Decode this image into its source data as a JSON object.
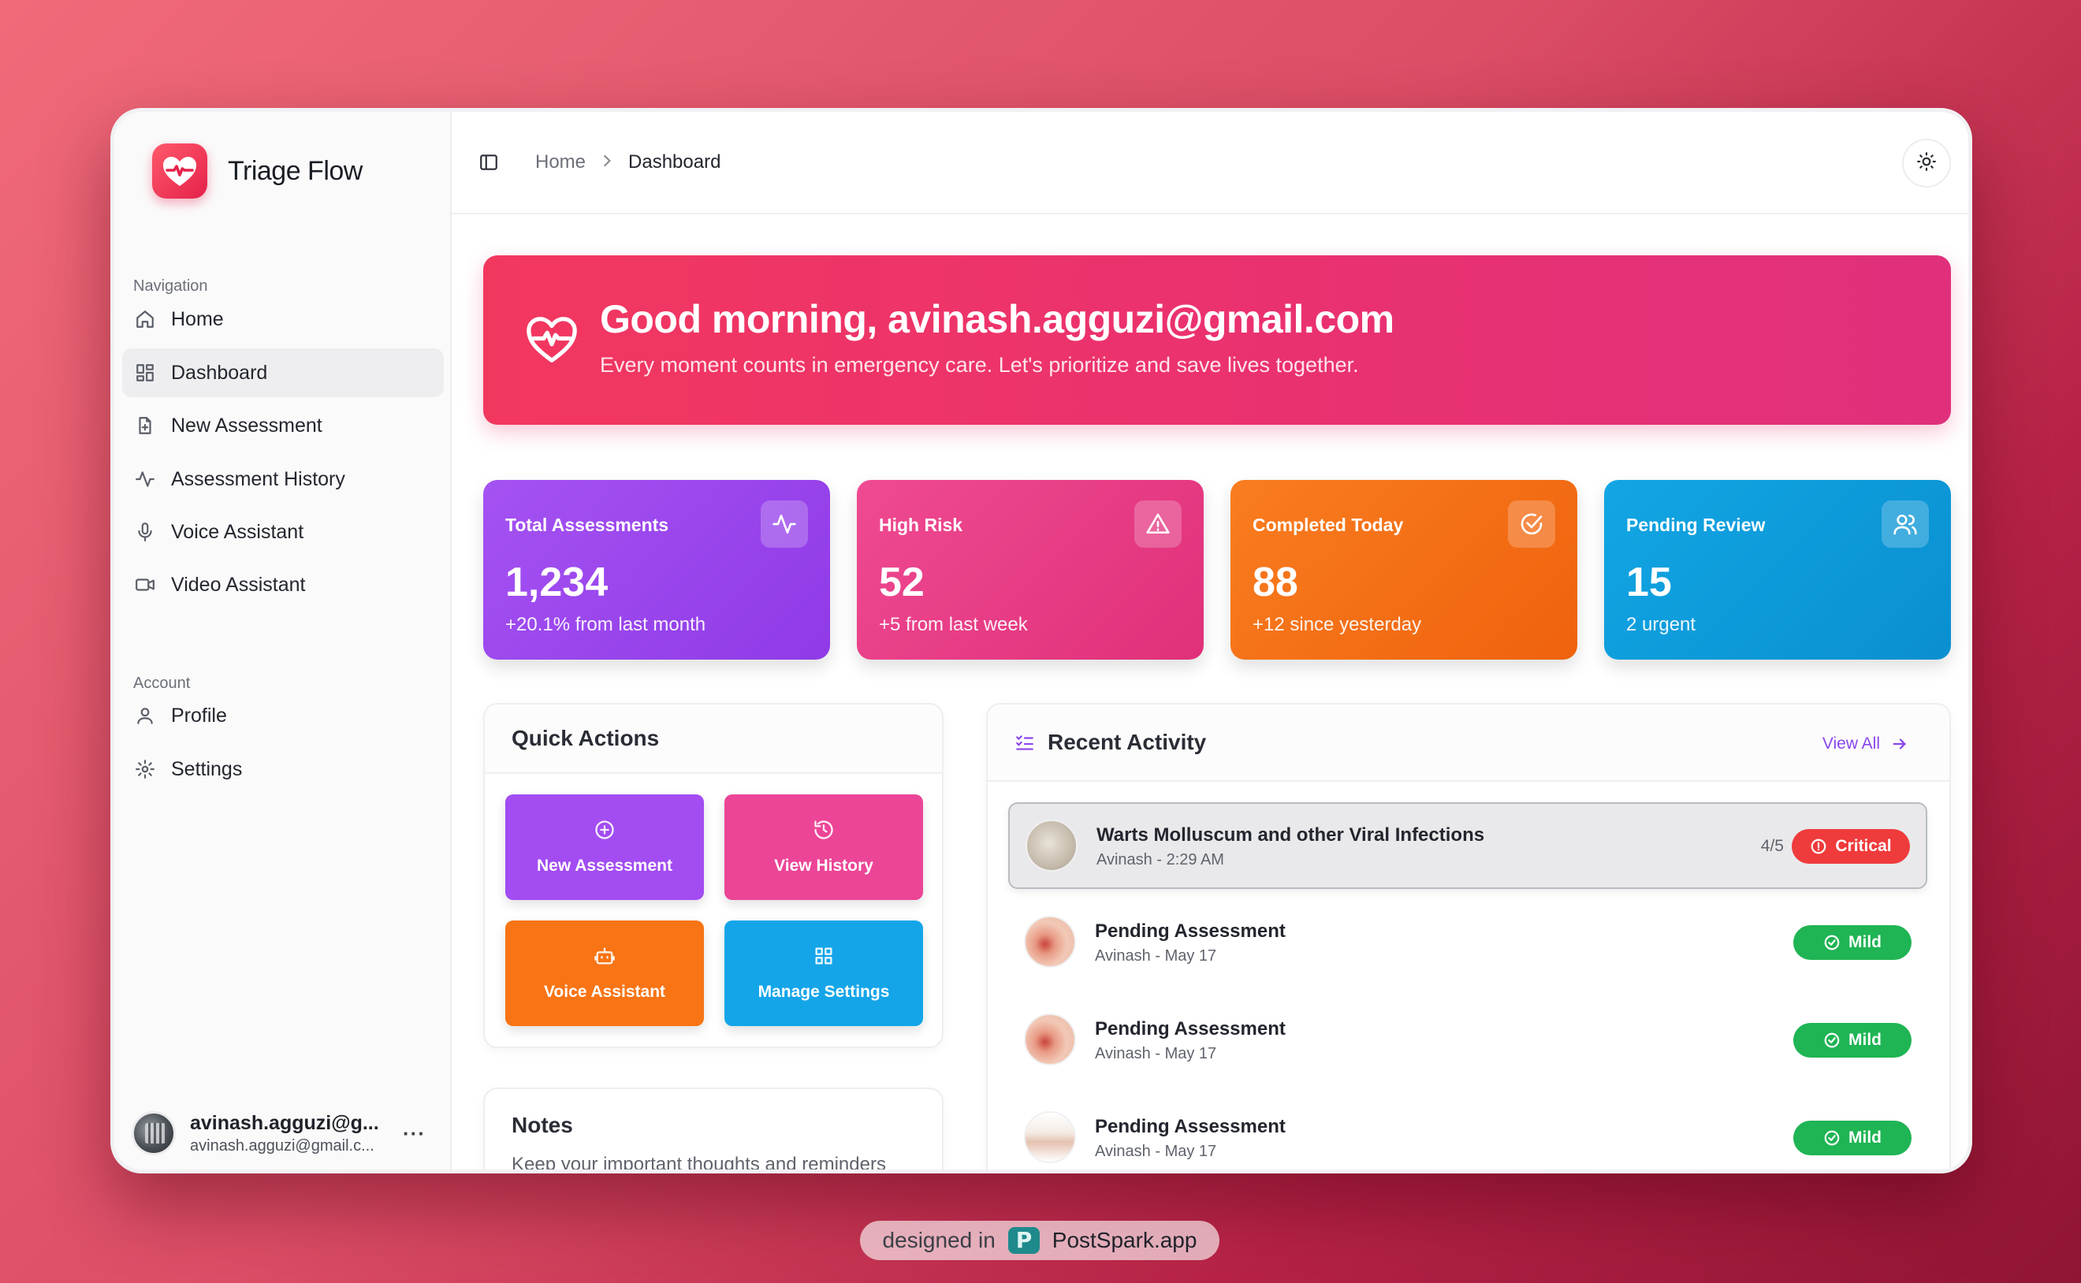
{
  "app": {
    "name": "Triage Flow",
    "accent": "#e4214a"
  },
  "sidebar": {
    "nav_label": "Navigation",
    "nav_items": [
      {
        "label": "Home",
        "icon": "home-icon",
        "active": false
      },
      {
        "label": "Dashboard",
        "icon": "dashboard-icon",
        "active": true
      },
      {
        "label": "New Assessment",
        "icon": "file-plus-icon",
        "active": false
      },
      {
        "label": "Assessment History",
        "icon": "activity-icon",
        "active": false
      },
      {
        "label": "Voice Assistant",
        "icon": "mic-icon",
        "active": false
      },
      {
        "label": "Video Assistant",
        "icon": "video-icon",
        "active": false
      }
    ],
    "account_label": "Account",
    "account_items": [
      {
        "label": "Profile",
        "icon": "user-icon"
      },
      {
        "label": "Settings",
        "icon": "gear-icon"
      }
    ],
    "user": {
      "name": "avinash.agguzi@g...",
      "email": "avinash.agguzi@gmail.c...",
      "more": "···"
    }
  },
  "topbar": {
    "breadcrumb": [
      "Home",
      "Dashboard"
    ],
    "theme_icon": "sun-icon"
  },
  "hero": {
    "title": "Good morning, avinash.agguzi@gmail.com",
    "subtitle": "Every moment counts in emergency care. Let's prioritize and save lives together."
  },
  "stats": [
    {
      "label": "Total Assessments",
      "value": "1,234",
      "note": "+20.1% from last month",
      "icon": "activity-icon",
      "color": "#9b44ee"
    },
    {
      "label": "High Risk",
      "value": "52",
      "note": "+5 from last week",
      "icon": "alert-triangle-icon",
      "color": "#e93a85"
    },
    {
      "label": "Completed Today",
      "value": "88",
      "note": "+12 since yesterday",
      "icon": "check-circle-icon",
      "color": "#f57219"
    },
    {
      "label": "Pending Review",
      "value": "15",
      "note": "2 urgent",
      "icon": "users-icon",
      "color": "#0f9fdb"
    }
  ],
  "quick_actions": {
    "title": "Quick Actions",
    "buttons": [
      {
        "label": "New Assessment",
        "icon": "plus-circle-icon",
        "color": "#a24cf2"
      },
      {
        "label": "View History",
        "icon": "history-icon",
        "color": "#ec4597"
      },
      {
        "label": "Voice Assistant",
        "icon": "bot-icon",
        "color": "#f87415"
      },
      {
        "label": "Manage Settings",
        "icon": "grid-icon",
        "color": "#14a5e9"
      }
    ]
  },
  "notes": {
    "title": "Notes",
    "subtitle": "Keep your important thoughts and reminders"
  },
  "recent_activity": {
    "title": "Recent Activity",
    "view_all": "View All",
    "items": [
      {
        "title": "Warts Molluscum and other Viral Infections",
        "subtitle": "Avinash - 2:29 AM",
        "score": "4/5",
        "severity": "Critical"
      },
      {
        "title": "Pending Assessment",
        "subtitle": "Avinash - May 17",
        "score": "",
        "severity": "Mild"
      },
      {
        "title": "Pending Assessment",
        "subtitle": "Avinash - May 17",
        "score": "",
        "severity": "Mild"
      },
      {
        "title": "Pending Assessment",
        "subtitle": "Avinash - May 17",
        "score": "",
        "severity": "Mild"
      }
    ]
  },
  "footer": {
    "prefix": "designed in",
    "brand": "PostSpark.app"
  }
}
